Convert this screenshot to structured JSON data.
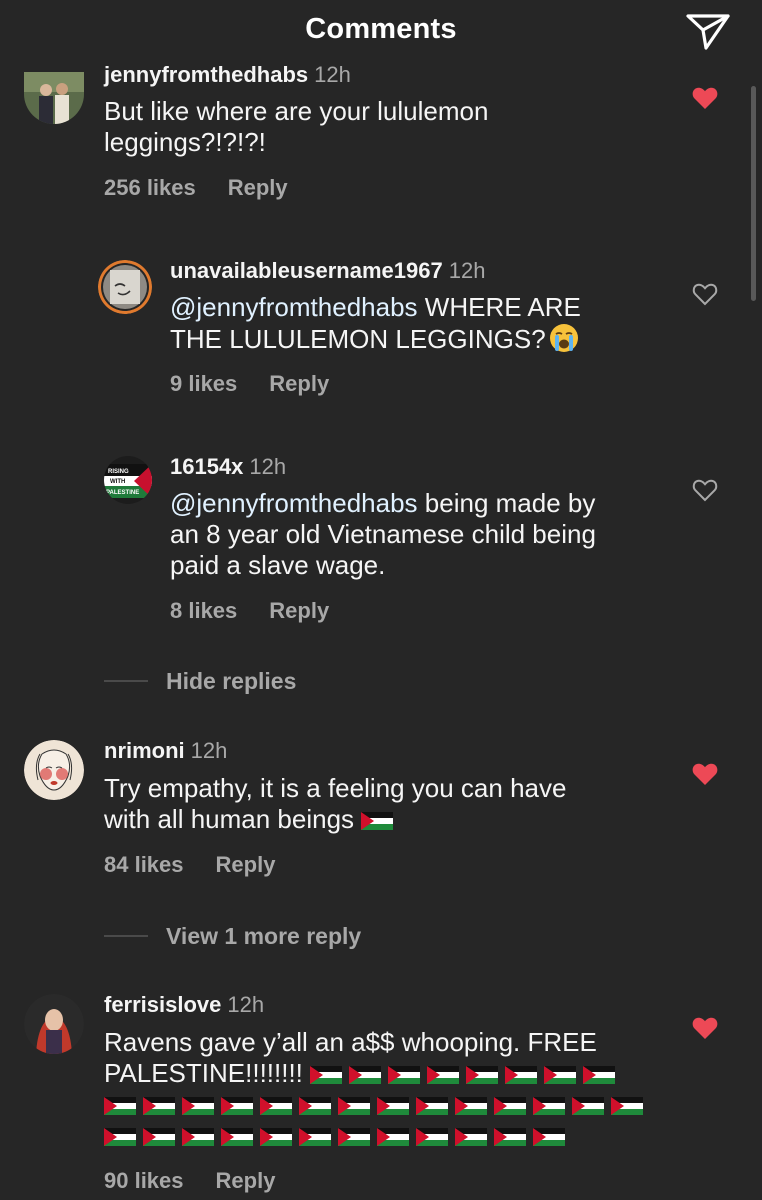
{
  "header": {
    "title": "Comments",
    "share_icon": "paper-plane-icon"
  },
  "colors": {
    "background": "#262626",
    "text": "#f5f5f5",
    "secondary_text": "#a8a8a8",
    "liked_heart": "#ed4956",
    "mention": "#e0f1ff"
  },
  "comments": [
    {
      "username": "jennyfromthedhabs",
      "time": "12h",
      "text": "But like where are your lululemon leggings?!?!?!",
      "likes": "256 likes",
      "reply": "Reply",
      "liked": true,
      "replies": [
        {
          "username": "unavailableusername1967",
          "time": "12h",
          "mention": "@jennyfromthedhabs",
          "text_line1": "WHERE ARE",
          "text_line2": "THE LULULEMON LEGGINGS?",
          "emoji": "loudly-crying-face",
          "likes": "9 likes",
          "reply": "Reply",
          "liked": false
        },
        {
          "username": "16154x",
          "time": "12h",
          "mention": "@jennyfromthedhabs",
          "text_line1": "being made by",
          "text_line2": "an 8 year old Vietnamese child being",
          "text_line3": "paid a slave wage.",
          "likes": "8 likes",
          "reply": "Reply",
          "liked": false,
          "avatar_text": [
            "RISING",
            "WITH",
            "PALESTINE"
          ]
        }
      ],
      "toggle": "Hide replies"
    },
    {
      "username": "nrimoni",
      "time": "12h",
      "text_line1": "Try empathy, it is a feeling you can have",
      "text_line2": "with all human beings",
      "flag_count": 1,
      "likes": "84 likes",
      "reply": "Reply",
      "liked": true,
      "toggle": "View 1 more reply"
    },
    {
      "username": "ferrisislove",
      "time": "12h",
      "text_line1": "Ravens gave y’all an a$$ whooping. FREE",
      "text_line2": "PALESTINE!!!!!!!!",
      "flags_line2": 8,
      "flags_line3": 14,
      "flags_line4": 12,
      "likes": "90 likes",
      "reply": "Reply",
      "liked": true
    }
  ]
}
